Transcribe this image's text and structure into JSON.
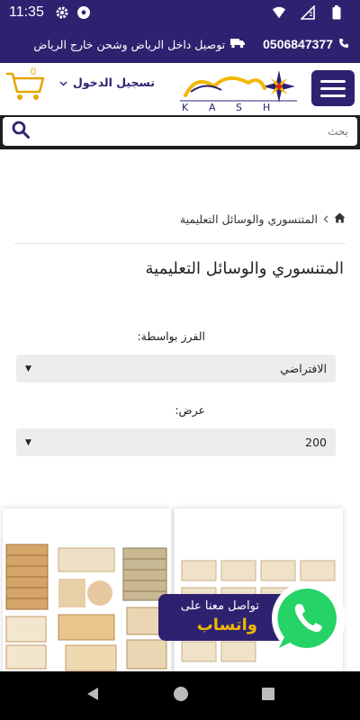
{
  "status_bar": {
    "time": "11:35"
  },
  "top_bar": {
    "phone": "0506847377",
    "delivery_text": "توصيل داخل الرياض وشحن خارج الرياض"
  },
  "header": {
    "login_label": "تسجيل الدخول",
    "cart_count": "0",
    "logo_letters": [
      "K",
      "A",
      "S",
      "H"
    ]
  },
  "search": {
    "placeholder": "بحث"
  },
  "breadcrumb": {
    "current": "المتنسوري والوسائل التعليمية"
  },
  "page": {
    "title": "المتنسوري والوسائل التعليمية",
    "sort_label": "الفرز بواسطة:",
    "sort_value": "الافتراضي",
    "show_label": "عرض:",
    "show_value": "200"
  },
  "whatsapp": {
    "line1": "تواصل معنا على",
    "line2": "واتساب",
    "color": "#25d366"
  },
  "colors": {
    "brand": "#2e2270",
    "accent": "#f2b705"
  }
}
